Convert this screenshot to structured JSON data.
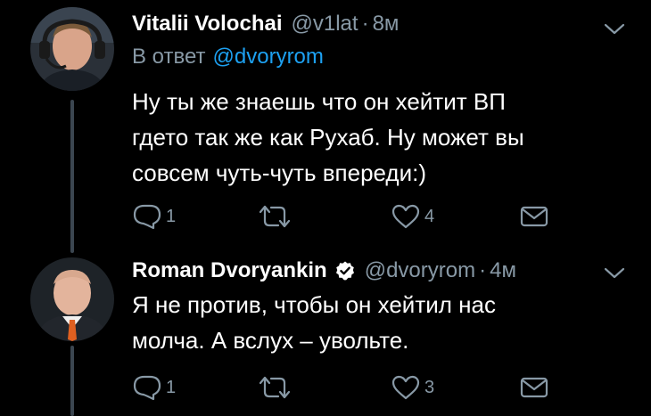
{
  "colors": {
    "background": "#000000",
    "text": "#ffffff",
    "muted": "#8899a6",
    "link": "#1da1f2",
    "thread_line": "#3b4650",
    "verified": "#ffffff"
  },
  "tweets": [
    {
      "display_name": "Vitalii Volochai",
      "handle": "@v1lat",
      "separator": "·",
      "time": "8м",
      "reply_prefix": "В ответ",
      "reply_mention": "@dvoryrom",
      "verified": false,
      "body_lines": [
        "Ну ты же знаешь что он хейтит ВП",
        "гдето так же как Рухаб. Ну может вы",
        "совсем чуть-чуть впереди:)"
      ],
      "actions": {
        "reply_icon": "reply-icon",
        "reply_count": "1",
        "retweet_icon": "retweet-icon",
        "like_icon": "heart-icon",
        "like_count": "4",
        "dm_icon": "envelope-icon"
      }
    },
    {
      "display_name": "Roman Dvoryankin",
      "handle": "@dvoryrom",
      "separator": "·",
      "time": "4м",
      "verified": true,
      "body_lines": [
        "Я не против, чтобы он хейтил нас",
        "молча. А вслух – увольте."
      ],
      "actions": {
        "reply_icon": "reply-icon",
        "reply_count": "1",
        "retweet_icon": "retweet-icon",
        "like_icon": "heart-icon",
        "like_count": "3",
        "dm_icon": "envelope-icon"
      }
    }
  ]
}
